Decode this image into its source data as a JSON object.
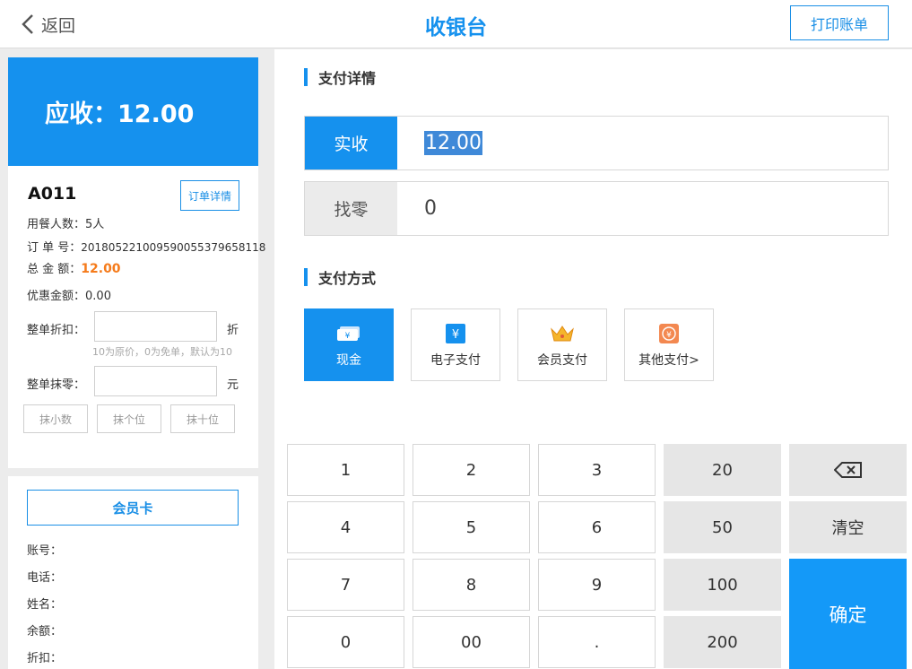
{
  "header": {
    "back_label": "返回",
    "title": "收银台",
    "print_label": "打印账单"
  },
  "summary": {
    "due_label": "应收：12.00"
  },
  "order": {
    "table_id": "A011",
    "detail_button": "订单详情",
    "diners_label": "用餐人数：",
    "diners_value": "5人",
    "order_no_label": "订 单 号：",
    "order_no_value": "20180522100959005537965811​8",
    "total_label": "总 金 额：",
    "total_value": "12.00",
    "discount_amount_label": "优惠金额：",
    "discount_amount_value": "0.00",
    "discount_label": "整单折扣：",
    "discount_unit": "折",
    "discount_hint": "10为原价，0为免单，默认为10",
    "rounding_label": "整单抹零：",
    "rounding_unit": "元",
    "round_buttons": [
      "抹小数",
      "抹个位",
      "抹十位"
    ]
  },
  "member": {
    "card_button": "会员卡",
    "account_label": "账号：",
    "phone_label": "电话：",
    "name_label": "姓名：",
    "balance_label": "余额：",
    "discount_label": "折扣："
  },
  "payment": {
    "detail_title": "支付详情",
    "received_label": "实收",
    "received_value": "12.00",
    "change_label": "找零",
    "change_value": "0",
    "method_title": "支付方式",
    "methods": [
      {
        "label": "现金",
        "icon": "cash-icon"
      },
      {
        "label": "电子支付",
        "icon": "yuan-icon"
      },
      {
        "label": "会员支付",
        "icon": "crown-icon"
      },
      {
        "label": "其他支付>",
        "icon": "coin-icon"
      }
    ],
    "selected_method": "现金"
  },
  "keypad": {
    "keys": [
      "1",
      "2",
      "3",
      "20",
      "4",
      "5",
      "6",
      "50",
      "清空",
      "7",
      "8",
      "9",
      "100",
      "0",
      "00",
      ".",
      "200"
    ],
    "backspace_icon": "backspace-icon",
    "confirm_label": "确定"
  },
  "colors": {
    "accent": "#1591ee",
    "orange": "#f57b1b",
    "coin": "#f38850"
  }
}
